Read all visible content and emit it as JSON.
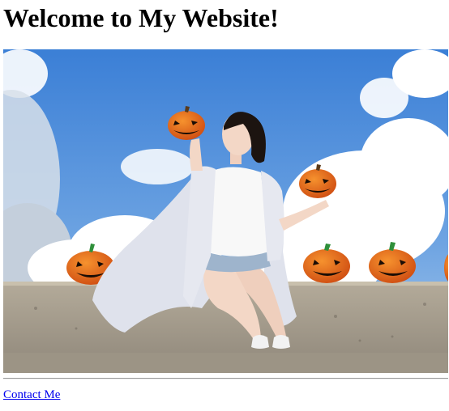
{
  "header": {
    "title": "Welcome to My Website!"
  },
  "hero": {
    "colors": {
      "sky_top": "#3f84d8",
      "sky_bottom": "#9cc2ea",
      "cloud": "#ffffff",
      "wall": "#a89f8e",
      "pumpkin": "#e8621a",
      "stem": "#2f8f3a",
      "shirt": "#f8f8f8",
      "cardigan": "#e4e6ee",
      "hair": "#1c1410"
    }
  },
  "footer": {
    "contact_label": "Contact Me"
  }
}
